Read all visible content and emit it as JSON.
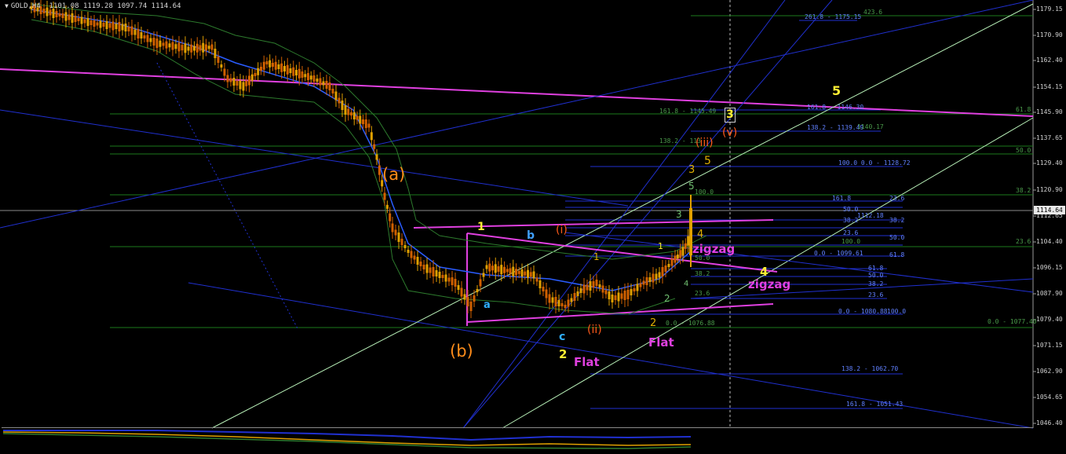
{
  "header": {
    "symbol_timeframe": "GOLD,H4",
    "ohlc": "1101.08 1119.28 1097.74 1114.64"
  },
  "price_axis": {
    "ticks": [
      "1179.15",
      "1170.90",
      "1162.40",
      "1154.15",
      "1145.90",
      "1137.65",
      "1129.40",
      "1120.90",
      "1112.65",
      "1104.40",
      "1096.15",
      "1087.90",
      "1079.40",
      "1071.15",
      "1062.90",
      "1054.65",
      "1046.40"
    ],
    "current_price": "1114.64"
  },
  "wave_labels": {
    "a_paren": "(a)",
    "b_paren": "(b)",
    "one": "1",
    "b_small": "b",
    "i_roman": "(i)",
    "a_small": "a",
    "c_small": "c",
    "two_left": "2",
    "flat_left": "Flat",
    "ii_roman": "(ii)",
    "two_mid": "2",
    "flat_mid": "Flat",
    "one_mid": "1",
    "one_mid2": "1",
    "two_green": "2",
    "three_green": "3",
    "four_green": "4",
    "five_green": "5",
    "three_yellow": "3",
    "five_orange": "5",
    "iii_roman": "(iii)",
    "four_yellow": "4",
    "zigzag_top": "zigzag",
    "four_big": "4",
    "zigzag_bottom": "zigzag",
    "five_big": "5",
    "three_box": "3",
    "v_roman": "(v)"
  },
  "fib_levels": {
    "f_2618_top": "261.8 - 1175.15",
    "f_4236": "423.6",
    "f_1618_a": "161.8 - 1145.49",
    "f_1618_b": "161.8 - 1146.30",
    "f_618_right": "61.8",
    "f_1382_a": "138.2 - 113",
    "f_1382_b": "138.2 - 1139.49",
    "f_1140": "1140.17",
    "f_50_right": "50.0",
    "f_100_00": "100.0    0.0 - 1128.72",
    "f_382_right": "38.2",
    "f_100_a": "100.0",
    "f_1618_c": "161.8",
    "f_236_a": "23.6",
    "f_50_b": "50.0",
    "f_1112": "1112.18",
    "f_382_b": "38.2",
    "f_382_c": "38.2",
    "f_236_b": "23.6",
    "f_50_c": "50.0",
    "f_100_b": "100.0",
    "f_236_right": "23.6",
    "f_0_1099": "0.0 - 1099.61",
    "f_618_b": "61.8",
    "f_500_small": "50.0",
    "f_382_small": "38.2",
    "f_618_c": "61.8",
    "f_50_d": "50.0",
    "f_382_d": "38.2",
    "f_236_c": "23.6",
    "f_236_small": "23.6",
    "f_0_1080": "0.0 - 1080.88",
    "f_100_c": "100.0",
    "f_0_1076": "0.0 - 1076.88",
    "f_0_1077": "0.0 - 1077.40",
    "f_1382_c": "138.2 - 1062.70",
    "f_1618_d": "161.8 - 1051.43"
  },
  "colors": {
    "bull_candle": "#e0a000",
    "bear_candle": "#d06000",
    "magenta": "#e040e0",
    "blue": "#2030d0",
    "green": "#1b7a1b",
    "lightgreen": "#b8f0b8",
    "yellow": "#ffee33",
    "orange": "#ff8c1a"
  }
}
